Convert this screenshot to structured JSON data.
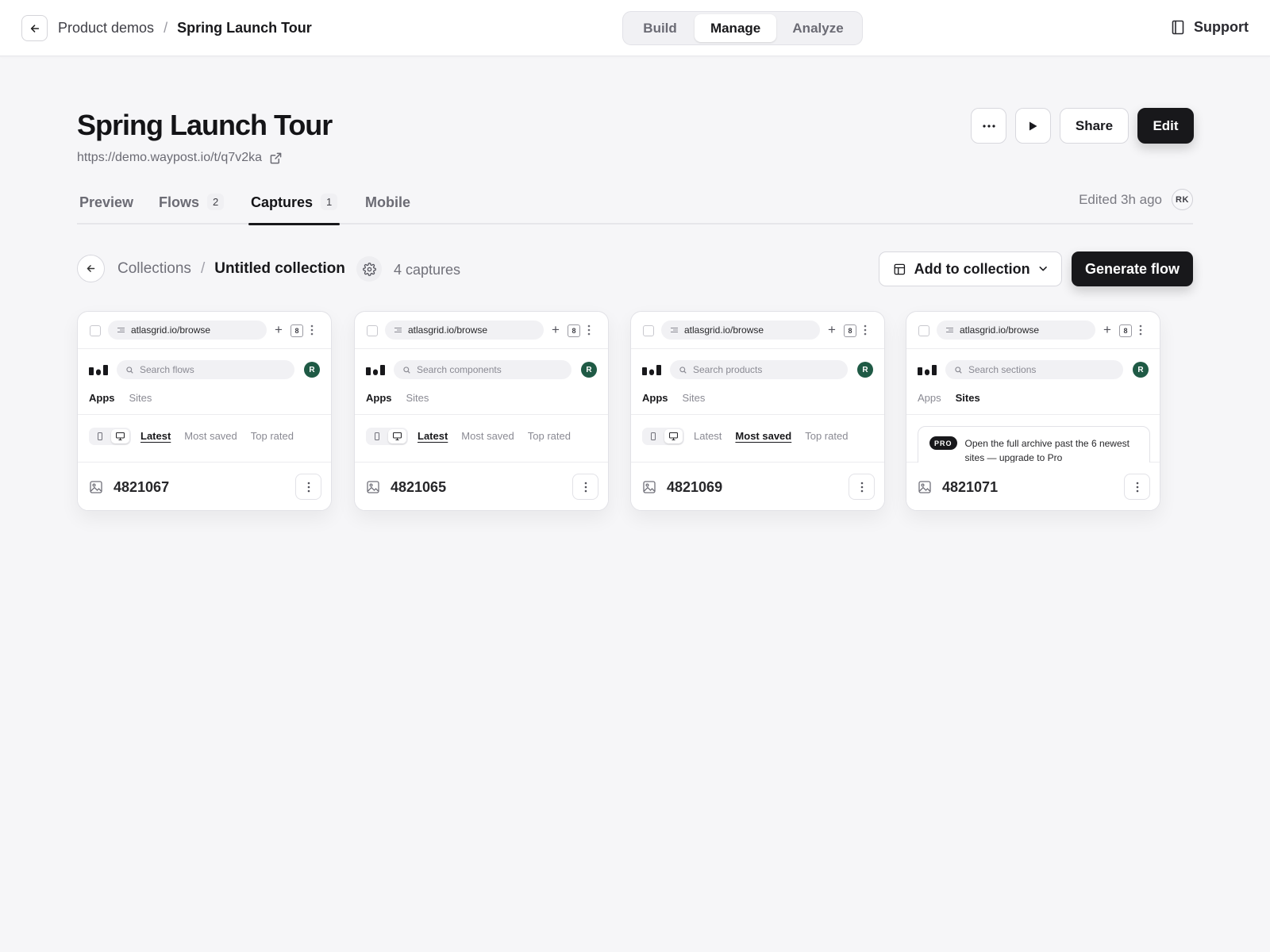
{
  "topbar": {
    "breadcrumb_parent": "Product demos",
    "breadcrumb_sep": "/",
    "breadcrumb_current": "Spring Launch Tour",
    "modes": [
      "Build",
      "Manage",
      "Analyze"
    ],
    "active_mode": "Manage",
    "support_label": "Support"
  },
  "header": {
    "title": "Spring Launch Tour",
    "url": "https://demo.waypost.io/t/q7v2ka",
    "more_icon": "more-horizontal-icon",
    "play_icon": "play-icon",
    "share_label": "Share",
    "edit_label": "Edit"
  },
  "tabs": {
    "items": [
      {
        "label": "Preview",
        "badge": ""
      },
      {
        "label": "Flows",
        "badge": "2"
      },
      {
        "label": "Captures",
        "badge": "1"
      },
      {
        "label": "Mobile",
        "badge": ""
      }
    ],
    "active": "Captures",
    "edited_text": "Edited 3h ago",
    "editor_initials": "RK"
  },
  "collection": {
    "parent": "Collections",
    "sep": "/",
    "name": "Untitled collection",
    "count_text": "4 captures",
    "add_label": "Add to collection",
    "generate_label": "Generate flow"
  },
  "cards": [
    {
      "url": "atlasgrid.io/browse",
      "tab_count": "8",
      "search_placeholder": "Search flows",
      "avatar": "R",
      "nav": [
        "Apps",
        "Sites"
      ],
      "nav_active": "Apps",
      "sort": [
        "Latest",
        "Most saved",
        "Top rated"
      ],
      "sort_active": "Latest",
      "id": "4821067"
    },
    {
      "url": "atlasgrid.io/browse",
      "tab_count": "8",
      "search_placeholder": "Search components",
      "avatar": "R",
      "nav": [
        "Apps",
        "Sites"
      ],
      "nav_active": "Apps",
      "sort": [
        "Latest",
        "Most saved",
        "Top rated"
      ],
      "sort_active": "Latest",
      "id": "4821065"
    },
    {
      "url": "atlasgrid.io/browse",
      "tab_count": "8",
      "search_placeholder": "Search products",
      "avatar": "R",
      "nav": [
        "Apps",
        "Sites"
      ],
      "nav_active": "Apps",
      "sort": [
        "Latest",
        "Most saved",
        "Top rated"
      ],
      "sort_active": "Most saved",
      "id": "4821069"
    },
    {
      "url": "atlasgrid.io/browse",
      "tab_count": "8",
      "search_placeholder": "Search sections",
      "avatar": "R",
      "nav": [
        "Apps",
        "Sites"
      ],
      "nav_active": "Sites",
      "pro_badge": "PRO",
      "pro_text": "Open the full archive past the 6 newest sites — upgrade to Pro",
      "id": "4821071"
    }
  ],
  "colors": {
    "background": "#f6f6f8",
    "primary_button": "#18181b",
    "avatar_green": "#1f5a45"
  }
}
